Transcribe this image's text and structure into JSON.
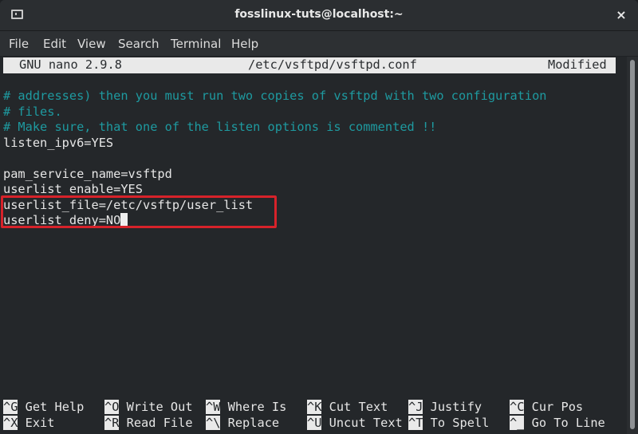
{
  "window": {
    "title": "fosslinux-tuts@localhost:~",
    "icon": "terminal-icon",
    "close_label": "×"
  },
  "menu": {
    "items": [
      {
        "label": "File"
      },
      {
        "label": "Edit"
      },
      {
        "label": "View"
      },
      {
        "label": "Search"
      },
      {
        "label": "Terminal"
      },
      {
        "label": "Help"
      }
    ]
  },
  "nano": {
    "version": "GNU nano 2.9.8",
    "filename": "/etc/vsftpd/vsftpd.conf",
    "status": "Modified"
  },
  "editor": {
    "lines": [
      {
        "text": "# addresses) then you must run two copies of vsftpd with two configuration",
        "type": "comment"
      },
      {
        "text": "# files.",
        "type": "comment"
      },
      {
        "text": "# Make sure, that one of the listen options is commented !!",
        "type": "comment"
      },
      {
        "text": "listen_ipv6=YES",
        "type": "setting"
      },
      {
        "text": "",
        "type": "blank"
      },
      {
        "text": "pam_service_name=vsftpd",
        "type": "setting"
      },
      {
        "text": "userlist_enable=YES",
        "type": "setting"
      },
      {
        "text": "userlist_file=/etc/vsftp/user_list",
        "type": "setting"
      },
      {
        "text": "userlist_deny=NO",
        "type": "setting"
      }
    ],
    "highlight_color": "#d7222a",
    "comment_color": "#1e9aa0"
  },
  "shortcuts": {
    "row1": [
      {
        "key": "^G",
        "label": "Get Help"
      },
      {
        "key": "^O",
        "label": "Write Out"
      },
      {
        "key": "^W",
        "label": "Where Is"
      },
      {
        "key": "^K",
        "label": "Cut Text"
      },
      {
        "key": "^J",
        "label": "Justify"
      },
      {
        "key": "^C",
        "label": "Cur Pos"
      }
    ],
    "row2": [
      {
        "key": "^X",
        "label": "Exit"
      },
      {
        "key": "^R",
        "label": "Read File"
      },
      {
        "key": "^\\",
        "label": "Replace"
      },
      {
        "key": "^U",
        "label": "Uncut Text"
      },
      {
        "key": "^T",
        "label": "To Spell"
      },
      {
        "key": "^_",
        "label": "Go To Line"
      }
    ]
  }
}
